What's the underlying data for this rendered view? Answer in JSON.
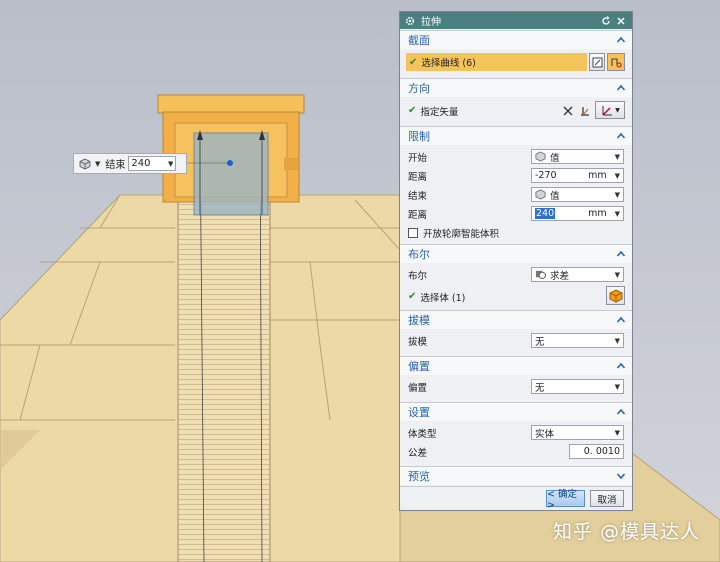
{
  "float_control": {
    "label": "结束",
    "value": "240"
  },
  "dialog": {
    "title": "拉伸",
    "sections": {
      "section": {
        "title": "截面",
        "select_curve": "选择曲线 (6)"
      },
      "direction": {
        "title": "方向",
        "specify_vector": "指定矢量"
      },
      "limits": {
        "title": "限制",
        "start_label": "开始",
        "start_value": "值",
        "distance1_label": "距离",
        "distance1_value": "-270",
        "distance1_unit": "mm",
        "end_label": "结束",
        "end_value": "值",
        "distance2_label": "距离",
        "distance2_value": "240",
        "distance2_unit": "mm",
        "open_profile": "开放轮廓智能体积"
      },
      "boolean": {
        "title": "布尔",
        "boolean_label": "布尔",
        "boolean_value": "求差",
        "select_body": "选择体 (1)"
      },
      "draft": {
        "title": "拔模",
        "draft_label": "拔模",
        "draft_value": "无"
      },
      "offset": {
        "title": "偏置",
        "offset_label": "偏置",
        "offset_value": "无"
      },
      "settings": {
        "title": "设置",
        "body_type_label": "体类型",
        "body_type_value": "实体",
        "tolerance_label": "公差",
        "tolerance_value": "0. 0010"
      },
      "preview": {
        "title": "预览"
      }
    },
    "ok_label": "< 确定 >",
    "cancel_label": "取消"
  },
  "watermark": "知乎 @模具达人",
  "colors": {
    "title_bar": "#4c7f7f",
    "section_title": "#2a63b2",
    "highlight": "#f4c35a",
    "model_tan": "#ecd9a6",
    "model_orange": "#f0a830"
  }
}
